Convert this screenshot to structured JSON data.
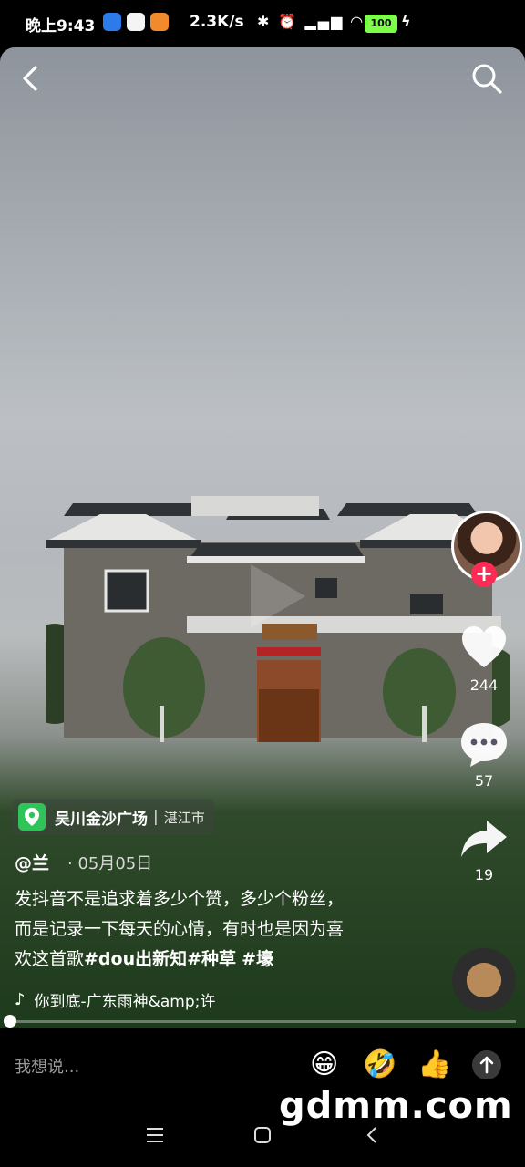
{
  "status_bar": {
    "time": "晚上9:43",
    "net_speed": "2.3K/s",
    "battery": "100"
  },
  "video": {
    "likes": "244",
    "comments": "57",
    "shares": "19"
  },
  "location": {
    "name": "吴川金沙广场",
    "city": "湛江市"
  },
  "post": {
    "author": "@兰",
    "date": "05月05日",
    "caption_line1": "发抖音不是追求着多少个赞，多少个粉丝，",
    "caption_line2": "而是记录一下每天的心情，有时也是因为喜",
    "caption_line3_text": "欢这首歌",
    "tags": [
      "#dou出新知",
      "#种草",
      "#壕"
    ],
    "music": "你到底-广东雨神&amp;许"
  },
  "comment_bar": {
    "placeholder": "我想说..."
  },
  "watermark": "gdmm.com",
  "colors": {
    "follow_red": "#fe2c55",
    "location_green": "#2fc45a",
    "battery_green": "#7dff4a"
  },
  "icons": [
    "back-icon",
    "search-icon",
    "heart-icon",
    "comment-icon",
    "share-icon",
    "location-icon",
    "music-note-icon",
    "send-icon",
    "nav-menu-icon",
    "nav-home-icon",
    "nav-back-icon"
  ]
}
